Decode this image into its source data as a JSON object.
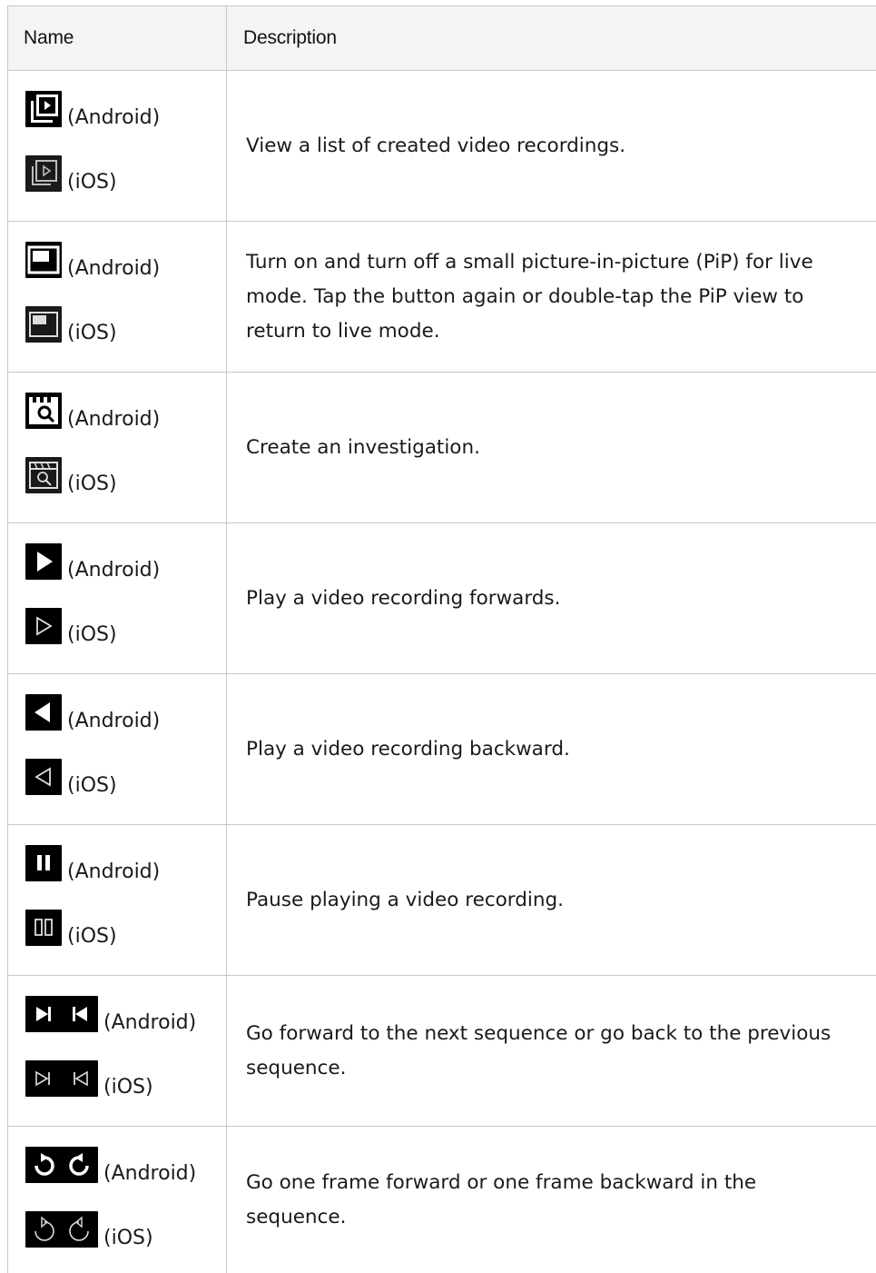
{
  "table": {
    "headers": {
      "name": "Name",
      "description": "Description"
    },
    "rows": [
      {
        "android_icon": "recordings-list-icon",
        "ios_icon": "recordings-list-icon",
        "android_label": "(Android)",
        "ios_label": "(iOS)",
        "description": "View a list of created video recordings."
      },
      {
        "android_icon": "picture-in-picture-icon",
        "ios_icon": "picture-in-picture-icon",
        "android_label": "(Android)",
        "ios_label": "(iOS)",
        "description": "Turn on and turn off a small picture-in-picture (PiP) for live mode. Tap the button again or double-tap the PiP view to return to live mode."
      },
      {
        "android_icon": "investigation-icon",
        "ios_icon": "investigation-icon",
        "android_label": "(Android)",
        "ios_label": "(iOS)",
        "description": "Create an investigation."
      },
      {
        "android_icon": "play-forward-icon",
        "ios_icon": "play-forward-icon",
        "android_label": "(Android)",
        "ios_label": "(iOS)",
        "description": "Play a video recording forwards."
      },
      {
        "android_icon": "play-backward-icon",
        "ios_icon": "play-backward-icon",
        "android_label": "(Android)",
        "ios_label": "(iOS)",
        "description": "Play a video recording backward."
      },
      {
        "android_icon": "pause-icon",
        "ios_icon": "pause-icon",
        "android_label": "(Android)",
        "ios_label": "(iOS)",
        "description": "Pause playing a video recording."
      },
      {
        "android_icon": "next-previous-sequence-icons",
        "ios_icon": "next-previous-sequence-icons",
        "android_label": "(Android)",
        "ios_label": "(iOS)",
        "description": "Go forward to the next sequence or go back to the previous sequence."
      },
      {
        "android_icon": "frame-forward-backward-icons",
        "ios_icon": "frame-forward-backward-icons",
        "android_label": "(Android)",
        "ios_label": "(iOS)",
        "description": "Go one frame forward or one frame backward in the sequence."
      }
    ]
  },
  "colors": {
    "border": "#c8c8c8",
    "header_bg": "#f4f4f4",
    "icon_bg": "#000000",
    "text": "#1a1a1a"
  }
}
